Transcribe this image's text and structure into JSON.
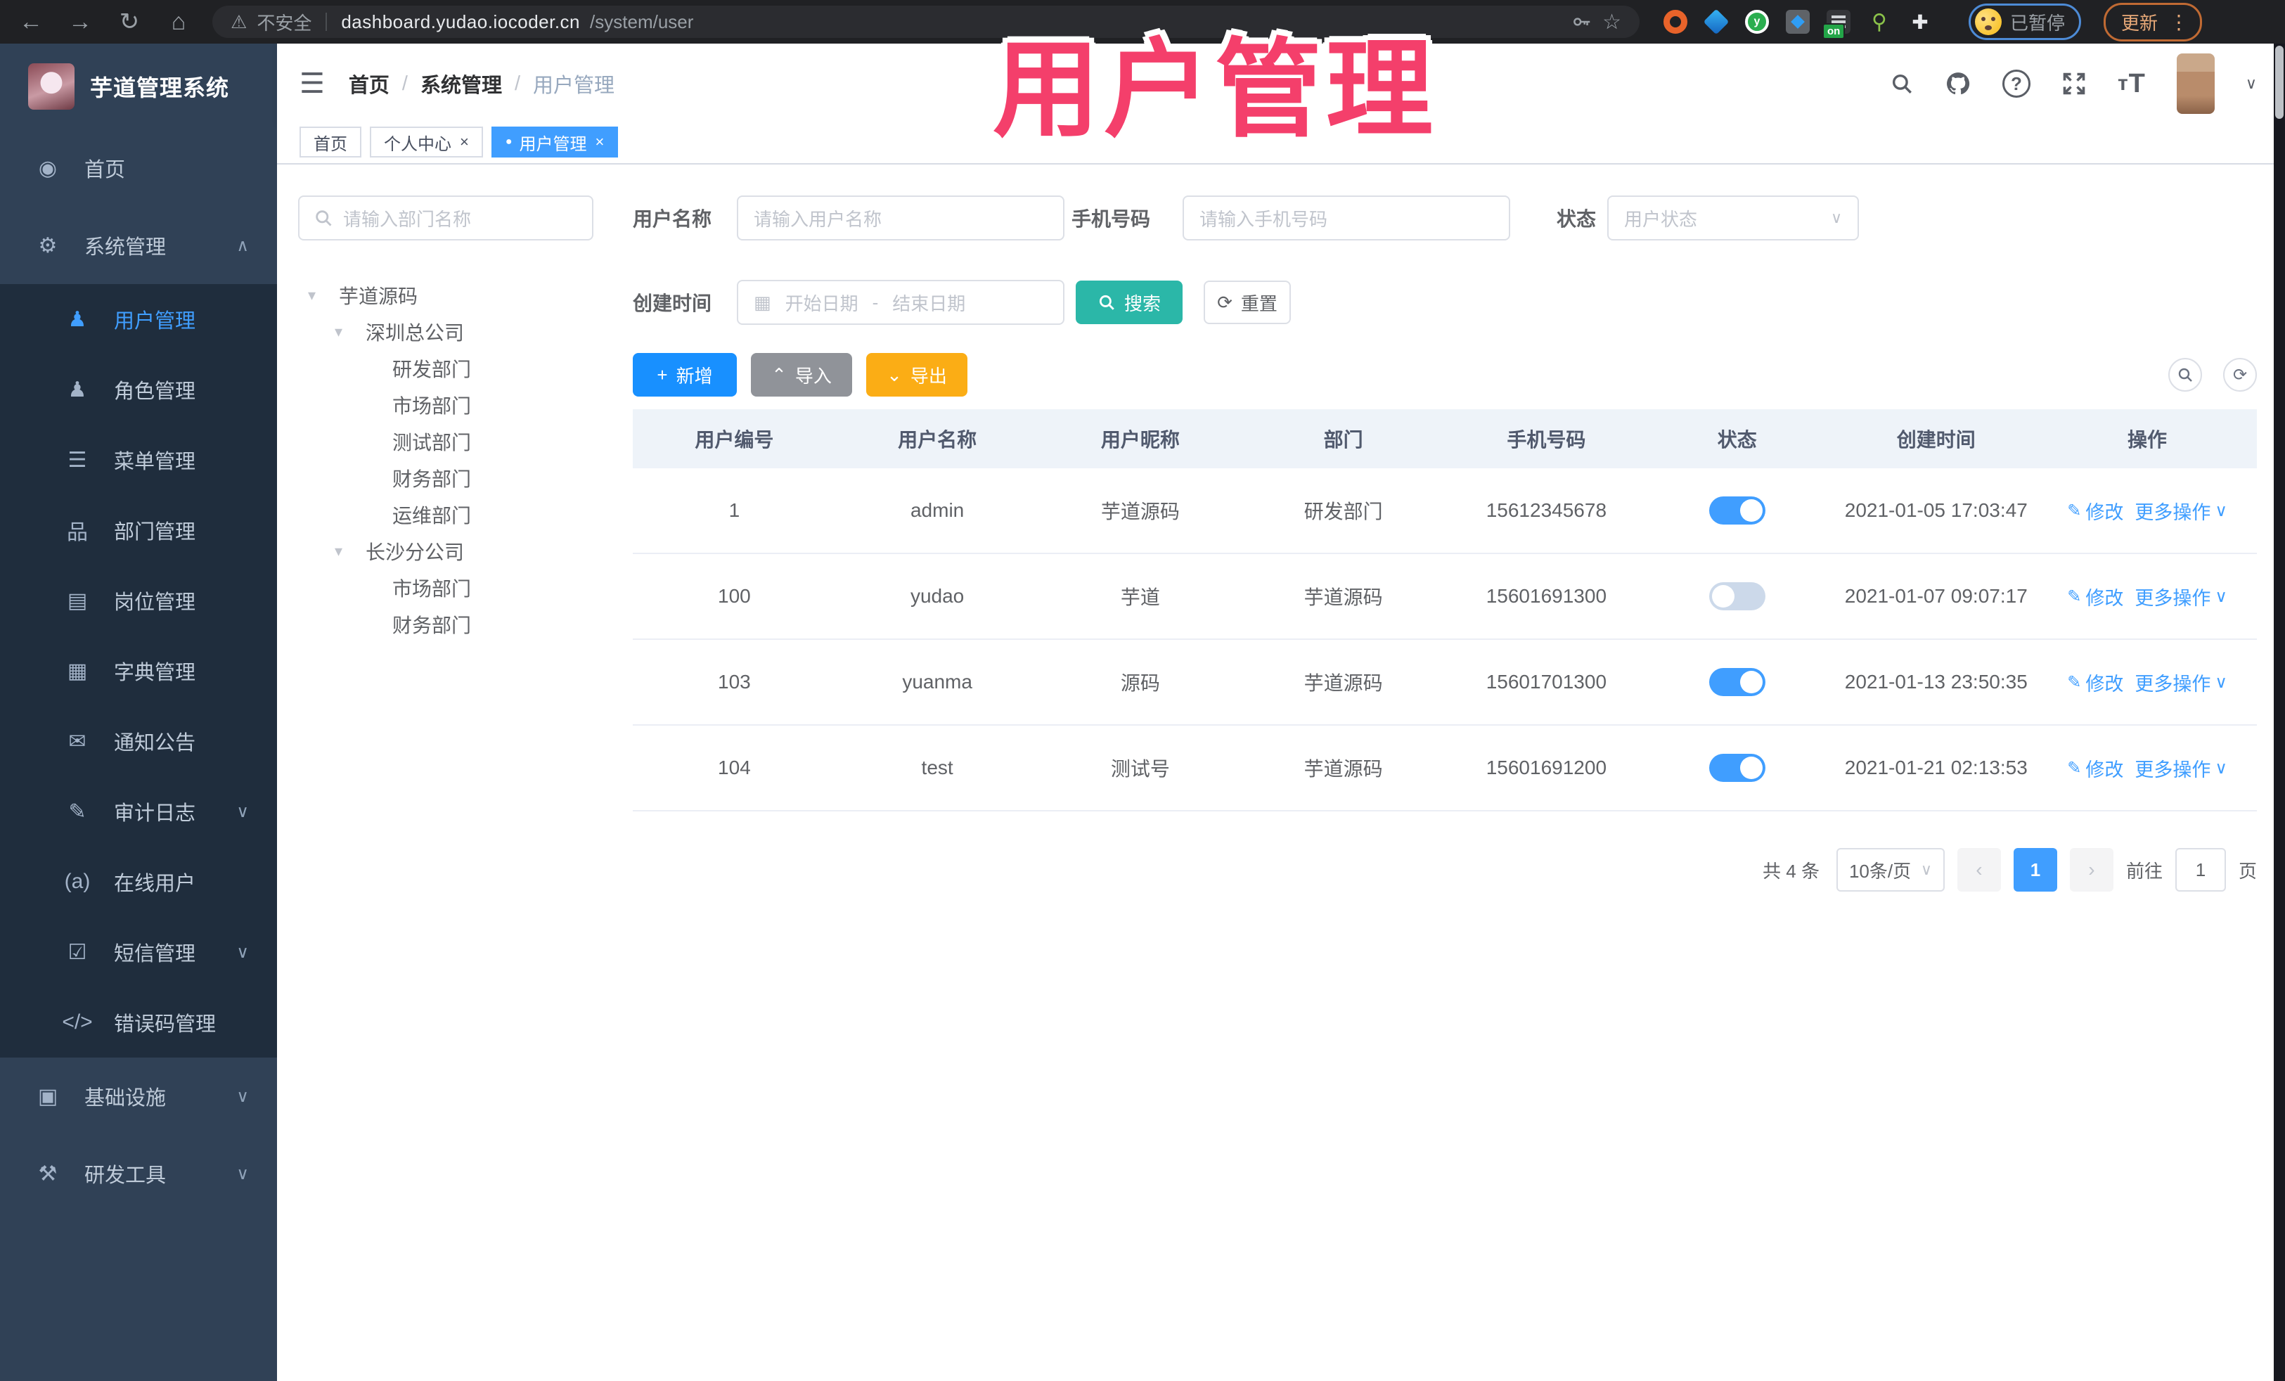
{
  "browser": {
    "security": "不安全",
    "url_host": "dashboard.yudao.iocoder.cn",
    "url_path": "/system/user",
    "extension_badge": "on",
    "profile_status": "已暂停",
    "update": "更新"
  },
  "header": {
    "breadcrumb": [
      "首页",
      "系统管理",
      "用户管理"
    ],
    "separator": "/"
  },
  "tabs": [
    {
      "label": "首页",
      "closable": false,
      "active": false
    },
    {
      "label": "个人中心",
      "closable": true,
      "active": false
    },
    {
      "label": "用户管理",
      "closable": true,
      "active": true
    }
  ],
  "sidebar": {
    "title": "芋道管理系统",
    "items": [
      {
        "label": "首页",
        "icon": "dashboard",
        "level": "top"
      },
      {
        "label": "系统管理",
        "icon": "gear",
        "level": "top",
        "chevron": "up"
      },
      {
        "label": "用户管理",
        "icon": "user",
        "level": "sub",
        "active": true
      },
      {
        "label": "角色管理",
        "icon": "role",
        "level": "sub"
      },
      {
        "label": "菜单管理",
        "icon": "menu",
        "level": "sub"
      },
      {
        "label": "部门管理",
        "icon": "dept",
        "level": "sub"
      },
      {
        "label": "岗位管理",
        "icon": "post",
        "level": "sub"
      },
      {
        "label": "字典管理",
        "icon": "dict",
        "level": "sub"
      },
      {
        "label": "通知公告",
        "icon": "notice",
        "level": "sub"
      },
      {
        "label": "审计日志",
        "icon": "audit",
        "level": "sub",
        "chevron": "down"
      },
      {
        "label": "在线用户",
        "icon": "online",
        "level": "sub"
      },
      {
        "label": "短信管理",
        "icon": "sms",
        "level": "sub",
        "chevron": "down"
      },
      {
        "label": "错误码管理",
        "icon": "errcode",
        "level": "sub"
      },
      {
        "label": "基础设施",
        "icon": "infra",
        "level": "top",
        "chevron": "down"
      },
      {
        "label": "研发工具",
        "icon": "tools",
        "level": "top",
        "chevron": "down"
      }
    ]
  },
  "tree": {
    "search_placeholder": "请输入部门名称",
    "nodes": [
      {
        "label": "芋道源码",
        "depth": 0,
        "caret": true
      },
      {
        "label": "深圳总公司",
        "depth": 1,
        "caret": true
      },
      {
        "label": "研发部门",
        "depth": 2
      },
      {
        "label": "市场部门",
        "depth": 2
      },
      {
        "label": "测试部门",
        "depth": 2
      },
      {
        "label": "财务部门",
        "depth": 2
      },
      {
        "label": "运维部门",
        "depth": 2
      },
      {
        "label": "长沙分公司",
        "depth": 1,
        "caret": true
      },
      {
        "label": "市场部门",
        "depth": 2
      },
      {
        "label": "财务部门",
        "depth": 2
      }
    ]
  },
  "filters": {
    "username_label": "用户名称",
    "username_placeholder": "请输入用户名称",
    "mobile_label": "手机号码",
    "mobile_placeholder": "请输入手机号码",
    "status_label": "状态",
    "status_placeholder": "用户状态",
    "created_label": "创建时间",
    "date_start": "开始日期",
    "date_separator": "-",
    "date_end": "结束日期",
    "search": "搜索",
    "reset": "重置"
  },
  "toolbar": {
    "add": "新增",
    "import": "导入",
    "export": "导出"
  },
  "table": {
    "columns": [
      "用户编号",
      "用户名称",
      "用户昵称",
      "部门",
      "手机号码",
      "状态",
      "创建时间",
      "操作"
    ],
    "rows": [
      {
        "id": "1",
        "username": "admin",
        "nickname": "芋道源码",
        "dept": "研发部门",
        "mobile": "15612345678",
        "status_on": true,
        "created": "2021-01-05 17:03:47"
      },
      {
        "id": "100",
        "username": "yudao",
        "nickname": "芋道",
        "dept": "芋道源码",
        "mobile": "15601691300",
        "status_on": false,
        "created": "2021-01-07 09:07:17"
      },
      {
        "id": "103",
        "username": "yuanma",
        "nickname": "源码",
        "dept": "芋道源码",
        "mobile": "15601701300",
        "status_on": true,
        "created": "2021-01-13 23:50:35"
      },
      {
        "id": "104",
        "username": "test",
        "nickname": "测试号",
        "dept": "芋道源码",
        "mobile": "15601691200",
        "status_on": true,
        "created": "2021-01-21 02:13:53"
      }
    ],
    "action_edit": "修改",
    "action_more": "更多操作"
  },
  "pagination": {
    "total": "共 4 条",
    "page_size": "10条/页",
    "current_page": "1",
    "goto_label": "前往",
    "goto_value": "1",
    "page_suffix": "页"
  },
  "overlay": {
    "title": "用户管理"
  },
  "glyphs": {
    "back": "←",
    "forward": "→",
    "reload": "↻",
    "home": "⌂",
    "warning": "⚠",
    "star": "☆",
    "kebab": "⋮",
    "hamburger": "☰",
    "help": "?",
    "font_small": "т",
    "font_big": "T",
    "caret": "▾",
    "close": "×",
    "dot": "●",
    "chevron_up": "∧",
    "chevron_down": "∨",
    "dropdown": "∨",
    "pencil": "✎",
    "refresh": "⟳",
    "calendar": "▦",
    "prev": "‹",
    "next": "›",
    "puzzle": "✚",
    "leafkey": "⚲",
    "menu_icons": {
      "dashboard": "◉",
      "gear": "⚙",
      "user": "♟",
      "role": "♟",
      "menu": "☰",
      "dept": "品",
      "post": "▤",
      "dict": "▦",
      "notice": "✉",
      "audit": "✎",
      "online": "(a)",
      "sms": "☑",
      "errcode": "</>",
      "infra": "▣",
      "tools": "⚒"
    }
  },
  "colors": {
    "accent_blue": "#409eff",
    "add_blue": "#1890ff",
    "search_teal": "#2bb7a8",
    "export_amber": "#fbad15",
    "import_gray": "#909399",
    "sidebar_bg": "#304156",
    "submenu_bg": "#1f2d3d",
    "overlay_pink": "#f43f6b",
    "toggle_off": "#ccd9ea"
  }
}
